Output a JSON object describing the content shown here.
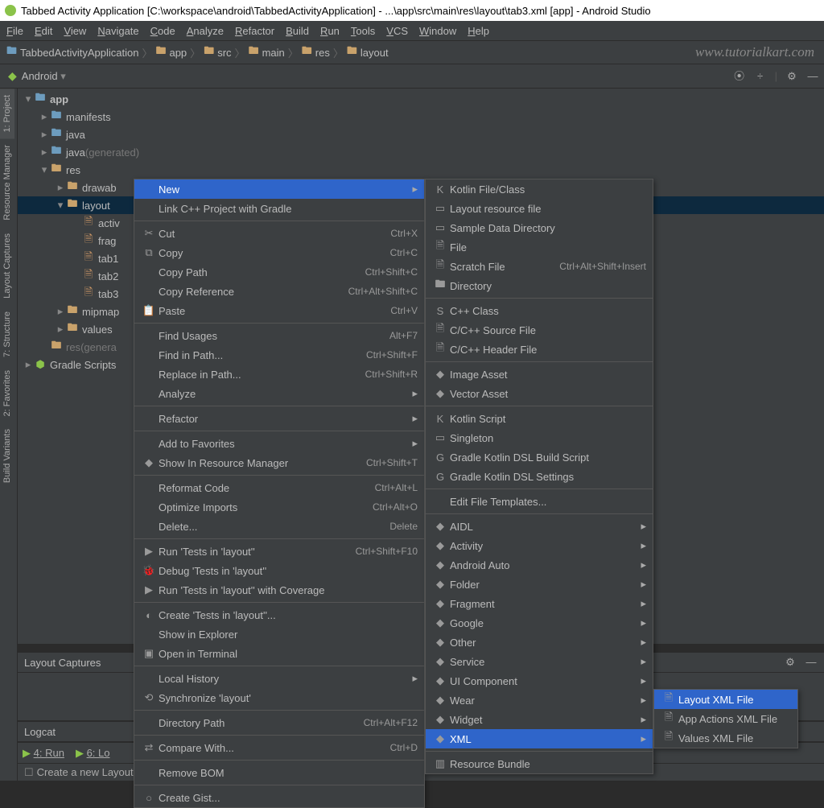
{
  "title": "Tabbed Activity Application [C:\\workspace\\android\\TabbedActivityApplication] - ...\\app\\src\\main\\res\\layout\\tab3.xml [app] - Android Studio",
  "menubar": [
    "File",
    "Edit",
    "View",
    "Navigate",
    "Code",
    "Analyze",
    "Refactor",
    "Build",
    "Run",
    "Tools",
    "VCS",
    "Window",
    "Help"
  ],
  "breadcrumbs": [
    "TabbedActivityApplication",
    "app",
    "src",
    "main",
    "res",
    "layout"
  ],
  "watermark": "www.tutorialkart.com",
  "project_label": "Android",
  "side_tabs": [
    "1: Project",
    "Resource Manager",
    "Layout Captures",
    "7: Structure",
    "2: Favorites",
    "Build Variants"
  ],
  "tree": {
    "app": "app",
    "manifests": "manifests",
    "java": "java",
    "java_gen": "java",
    "java_gen_suffix": "(generated)",
    "res": "res",
    "drawable": "drawab",
    "layout": "layout",
    "files": [
      "activ",
      "frag",
      "tab1",
      "tab2",
      "tab3"
    ],
    "mipmap": "mipmap",
    "values": "values",
    "res_gen": "res",
    "res_gen_suffix": "(genera",
    "gradle": "Gradle Scripts"
  },
  "ctx1": [
    {
      "label": "New",
      "shortcut": "",
      "sub": true,
      "highlight": true,
      "sep": false
    },
    {
      "label": "Link C++ Project with Gradle",
      "shortcut": "",
      "sep": true
    },
    {
      "icon": "✂",
      "label": "Cut",
      "shortcut": "Ctrl+X"
    },
    {
      "icon": "⧉",
      "label": "Copy",
      "shortcut": "Ctrl+C"
    },
    {
      "label": "Copy Path",
      "shortcut": "Ctrl+Shift+C"
    },
    {
      "label": "Copy Reference",
      "shortcut": "Ctrl+Alt+Shift+C"
    },
    {
      "icon": "📋",
      "label": "Paste",
      "shortcut": "Ctrl+V",
      "sep": true
    },
    {
      "label": "Find Usages",
      "shortcut": "Alt+F7"
    },
    {
      "label": "Find in Path...",
      "shortcut": "Ctrl+Shift+F"
    },
    {
      "label": "Replace in Path...",
      "shortcut": "Ctrl+Shift+R"
    },
    {
      "label": "Analyze",
      "sub": true,
      "sep": true
    },
    {
      "label": "Refactor",
      "sub": true,
      "sep": true
    },
    {
      "label": "Add to Favorites",
      "sub": true
    },
    {
      "icon": "◆",
      "label": "Show In Resource Manager",
      "shortcut": "Ctrl+Shift+T",
      "sep": true
    },
    {
      "label": "Reformat Code",
      "shortcut": "Ctrl+Alt+L"
    },
    {
      "label": "Optimize Imports",
      "shortcut": "Ctrl+Alt+O"
    },
    {
      "label": "Delete...",
      "shortcut": "Delete",
      "sep": true
    },
    {
      "icon": "▶",
      "iconColor": "andro",
      "label": "Run 'Tests in 'layout''",
      "shortcut": "Ctrl+Shift+F10"
    },
    {
      "icon": "🐞",
      "iconColor": "andro",
      "label": "Debug 'Tests in 'layout''"
    },
    {
      "icon": "▶",
      "label": "Run 'Tests in 'layout'' with Coverage",
      "sep": true
    },
    {
      "icon": "◐",
      "iconColor": "file-orange",
      "label": "Create 'Tests in 'layout''..."
    },
    {
      "label": "Show in Explorer"
    },
    {
      "icon": "▣",
      "label": "Open in Terminal",
      "sep": true
    },
    {
      "label": "Local History",
      "sub": true
    },
    {
      "icon": "⟲",
      "label": "Synchronize 'layout'",
      "sep": true
    },
    {
      "label": "Directory Path",
      "shortcut": "Ctrl+Alt+F12",
      "sep": true
    },
    {
      "icon": "⇄",
      "label": "Compare With...",
      "shortcut": "Ctrl+D",
      "sep": true
    },
    {
      "label": "Remove BOM",
      "sep": true
    },
    {
      "icon": "○",
      "label": "Create Gist..."
    }
  ],
  "ctx2": [
    {
      "icon": "K",
      "iconColor": "kotlin",
      "label": "Kotlin File/Class"
    },
    {
      "icon": "▭",
      "iconColor": "folder-tan",
      "label": "Layout resource file"
    },
    {
      "icon": "▭",
      "iconColor": "folder-tan",
      "label": "Sample Data Directory"
    },
    {
      "icon": "🗎",
      "label": "File"
    },
    {
      "icon": "🗎",
      "label": "Scratch File",
      "shortcut": "Ctrl+Alt+Shift+Insert"
    },
    {
      "icon": "🖿",
      "label": "Directory",
      "sep": true
    },
    {
      "icon": "S",
      "iconColor": "kotlin",
      "label": "C++ Class"
    },
    {
      "icon": "🗎",
      "label": "C/C++ Source File"
    },
    {
      "icon": "🗎",
      "iconColor": "file-orange",
      "label": "C/C++ Header File",
      "sep": true
    },
    {
      "icon": "◆",
      "iconColor": "andro",
      "label": "Image Asset"
    },
    {
      "icon": "◆",
      "iconColor": "andro",
      "label": "Vector Asset",
      "sep": true
    },
    {
      "icon": "K",
      "iconColor": "kotlin",
      "label": "Kotlin Script"
    },
    {
      "icon": "▭",
      "label": "Singleton"
    },
    {
      "icon": "G",
      "iconColor": "green-dot",
      "label": "Gradle Kotlin DSL Build Script"
    },
    {
      "icon": "G",
      "iconColor": "green-dot",
      "label": "Gradle Kotlin DSL Settings",
      "sep": true
    },
    {
      "label": "Edit File Templates...",
      "sep": true
    },
    {
      "icon": "◆",
      "iconColor": "andro",
      "label": "AIDL",
      "sub": true
    },
    {
      "icon": "◆",
      "iconColor": "andro",
      "label": "Activity",
      "sub": true
    },
    {
      "icon": "◆",
      "iconColor": "andro",
      "label": "Android Auto",
      "sub": true
    },
    {
      "icon": "◆",
      "iconColor": "andro",
      "label": "Folder",
      "sub": true
    },
    {
      "icon": "◆",
      "iconColor": "andro",
      "label": "Fragment",
      "sub": true
    },
    {
      "icon": "◆",
      "iconColor": "andro",
      "label": "Google",
      "sub": true
    },
    {
      "icon": "◆",
      "iconColor": "andro",
      "label": "Other",
      "sub": true
    },
    {
      "icon": "◆",
      "iconColor": "andro",
      "label": "Service",
      "sub": true
    },
    {
      "icon": "◆",
      "iconColor": "andro",
      "label": "UI Component",
      "sub": true
    },
    {
      "icon": "◆",
      "iconColor": "andro",
      "label": "Wear",
      "sub": true
    },
    {
      "icon": "◆",
      "iconColor": "andro",
      "label": "Widget",
      "sub": true
    },
    {
      "icon": "◆",
      "iconColor": "andro",
      "label": "XML",
      "sub": true,
      "highlight": true,
      "sep": true
    },
    {
      "icon": "▥",
      "label": "Resource Bundle"
    }
  ],
  "ctx3": [
    {
      "icon": "🗎",
      "label": "Layout XML File",
      "highlight": true
    },
    {
      "icon": "🗎",
      "label": "App Actions XML File"
    },
    {
      "icon": "🗎",
      "label": "Values XML File"
    }
  ],
  "layout_captures_header": "Layout Captures",
  "logcat_tab": "Logcat",
  "bottom_tabs": [
    "4: Run",
    "6: Lo"
  ],
  "status_text": "Create a new Layout"
}
